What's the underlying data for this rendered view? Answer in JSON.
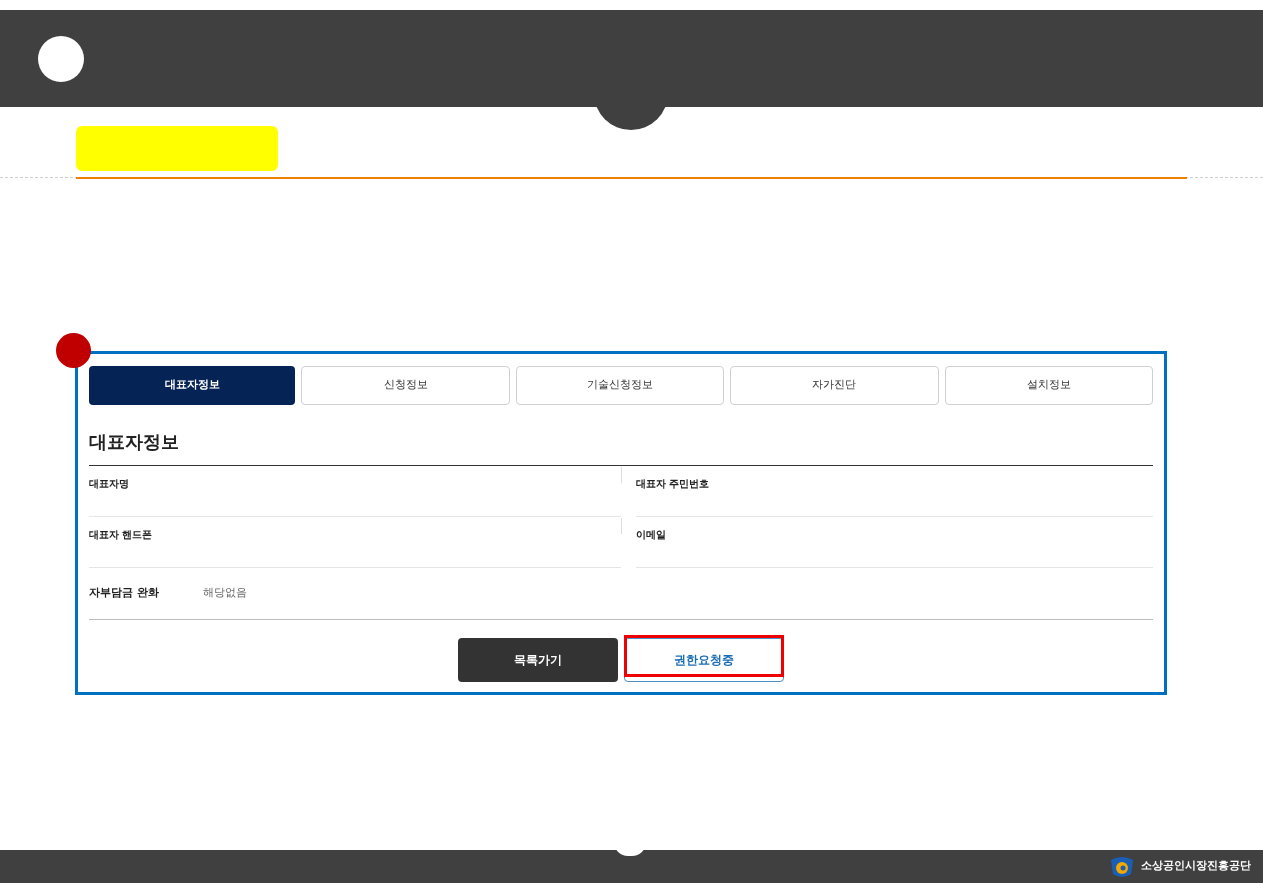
{
  "tabs": [
    {
      "label": "대표자정보",
      "selected": true
    },
    {
      "label": "신청정보",
      "selected": false
    },
    {
      "label": "기술신청정보",
      "selected": false
    },
    {
      "label": "자가진단",
      "selected": false
    },
    {
      "label": "설치정보",
      "selected": false
    }
  ],
  "section_title": "대표자정보",
  "fields": [
    {
      "label": "대표자명",
      "kind": "half"
    },
    {
      "label": "대표자 주민번호",
      "kind": "half"
    },
    {
      "label": "대표자 핸드폰",
      "kind": "half"
    },
    {
      "label": "이메일",
      "kind": "half"
    },
    {
      "label": "자부담금 완화",
      "value": "해당없음",
      "kind": "full"
    }
  ],
  "buttons": [
    {
      "label": "목록가기",
      "kind": "dark",
      "highlighted": false
    },
    {
      "label": "권한요청중",
      "kind": "outline",
      "highlighted": true
    }
  ],
  "footer": {
    "org_name": "소상공인시장진흥공단"
  }
}
